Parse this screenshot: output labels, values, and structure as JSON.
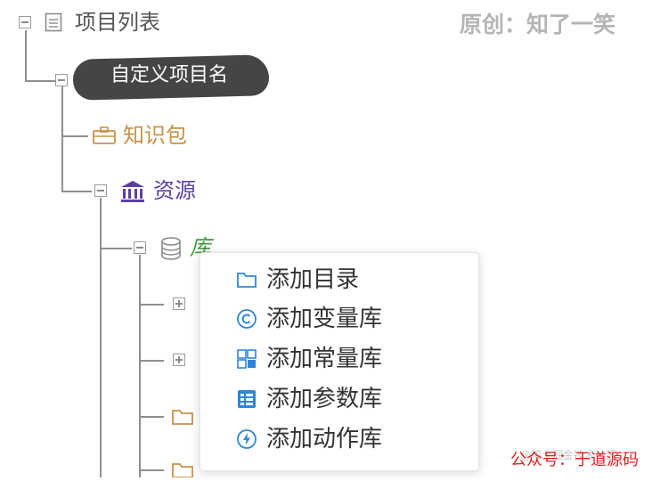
{
  "root": {
    "label": "项目列表"
  },
  "watermark": {
    "text": "原创：知了一笑"
  },
  "project": {
    "label": "自定义项目名"
  },
  "nodes": {
    "knowledge": {
      "label": "知识包"
    },
    "resource": {
      "label": "资源"
    },
    "library": {
      "label": "库"
    }
  },
  "context_menu": {
    "items": [
      {
        "label": "添加目录",
        "icon": "folder-icon"
      },
      {
        "label": "添加变量库",
        "icon": "copyright-c-icon"
      },
      {
        "label": "添加常量库",
        "icon": "grid-blocks-icon"
      },
      {
        "label": "添加参数库",
        "icon": "table-list-icon"
      },
      {
        "label": "添加动作库",
        "icon": "lightning-icon"
      }
    ]
  },
  "footer": {
    "credit": "公众号：于道源码",
    "faint_text": "@稀土掘金技术社区"
  },
  "colors": {
    "tree_text": "#555555",
    "knowledge": "#c69248",
    "resource": "#5b3fa6",
    "library": "#3c9a3c",
    "menu_icon": "#2f86d8",
    "credit": "#e02020"
  }
}
